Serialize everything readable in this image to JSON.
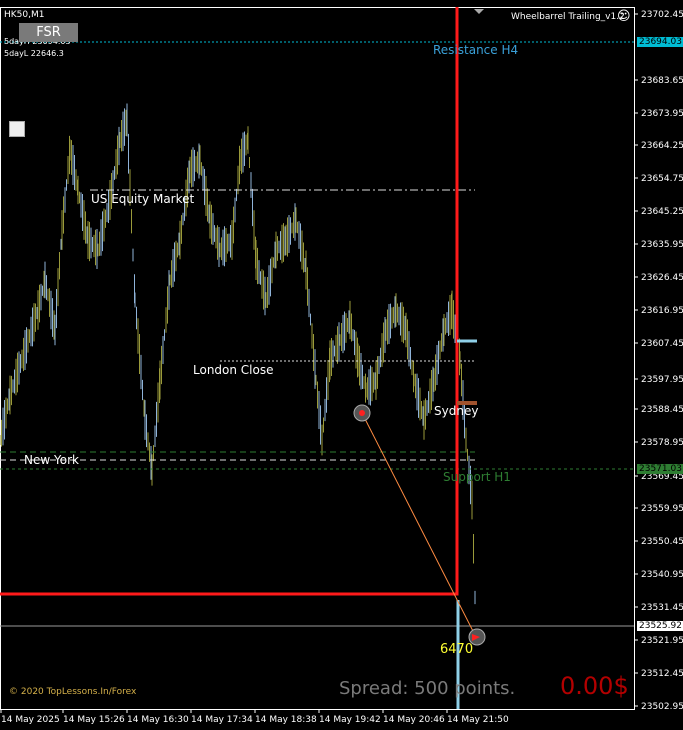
{
  "chart": {
    "symbol_timeframe": "HK50,M1",
    "ea_name": "Wheelbarrel Trailing_v1.2",
    "smiley_icon": "smiley-face-icon",
    "info_5day_high": "5dayH 23694.03",
    "info_5day_low": "5dayL 22646.3",
    "fsr_button": "FSR",
    "y_ticks": [
      "23702.45",
      "23694.03",
      "23683.65",
      "23673.95",
      "23664.25",
      "23654.75",
      "23645.25",
      "23635.95",
      "23626.45",
      "23616.95",
      "23607.45",
      "23597.95",
      "23588.45",
      "23578.95",
      "23569.45",
      "23559.95",
      "23550.45",
      "23540.95",
      "23531.45",
      "23525.92",
      "23521.95",
      "23512.45",
      "23502.95"
    ],
    "x_ticks": [
      "14 May 2025",
      "14 May 15:26",
      "14 May 16:30",
      "14 May 17:34",
      "14 May 18:38",
      "14 May 19:42",
      "14 May 20:46",
      "14 May 21:50"
    ],
    "resistance_label": "Resistance H4",
    "resistance_price": "23694.03",
    "support_label": "Support H1",
    "support_price": "23571.03",
    "current_price": "23525.92",
    "sessions": {
      "us_equity": "US Equity Market",
      "london_close": "London Close",
      "sydney": "Sydney",
      "new_york": "New York"
    },
    "trade_points": "6470",
    "spread_text": "Spread: 500 points.",
    "profit_text": "0.00$",
    "copyright": "© 2020 TopLessons.In/Forex",
    "colors": {
      "background": "#000000",
      "candle_up": "#8fb3d9",
      "candle_down": "#9a9a3a",
      "red_box": "#ff1a1a",
      "resistance": "#00bcd4",
      "support": "#2e7d32",
      "spread": "#7a7a7a",
      "profit": "#b30000",
      "points": "#ffff33"
    }
  }
}
